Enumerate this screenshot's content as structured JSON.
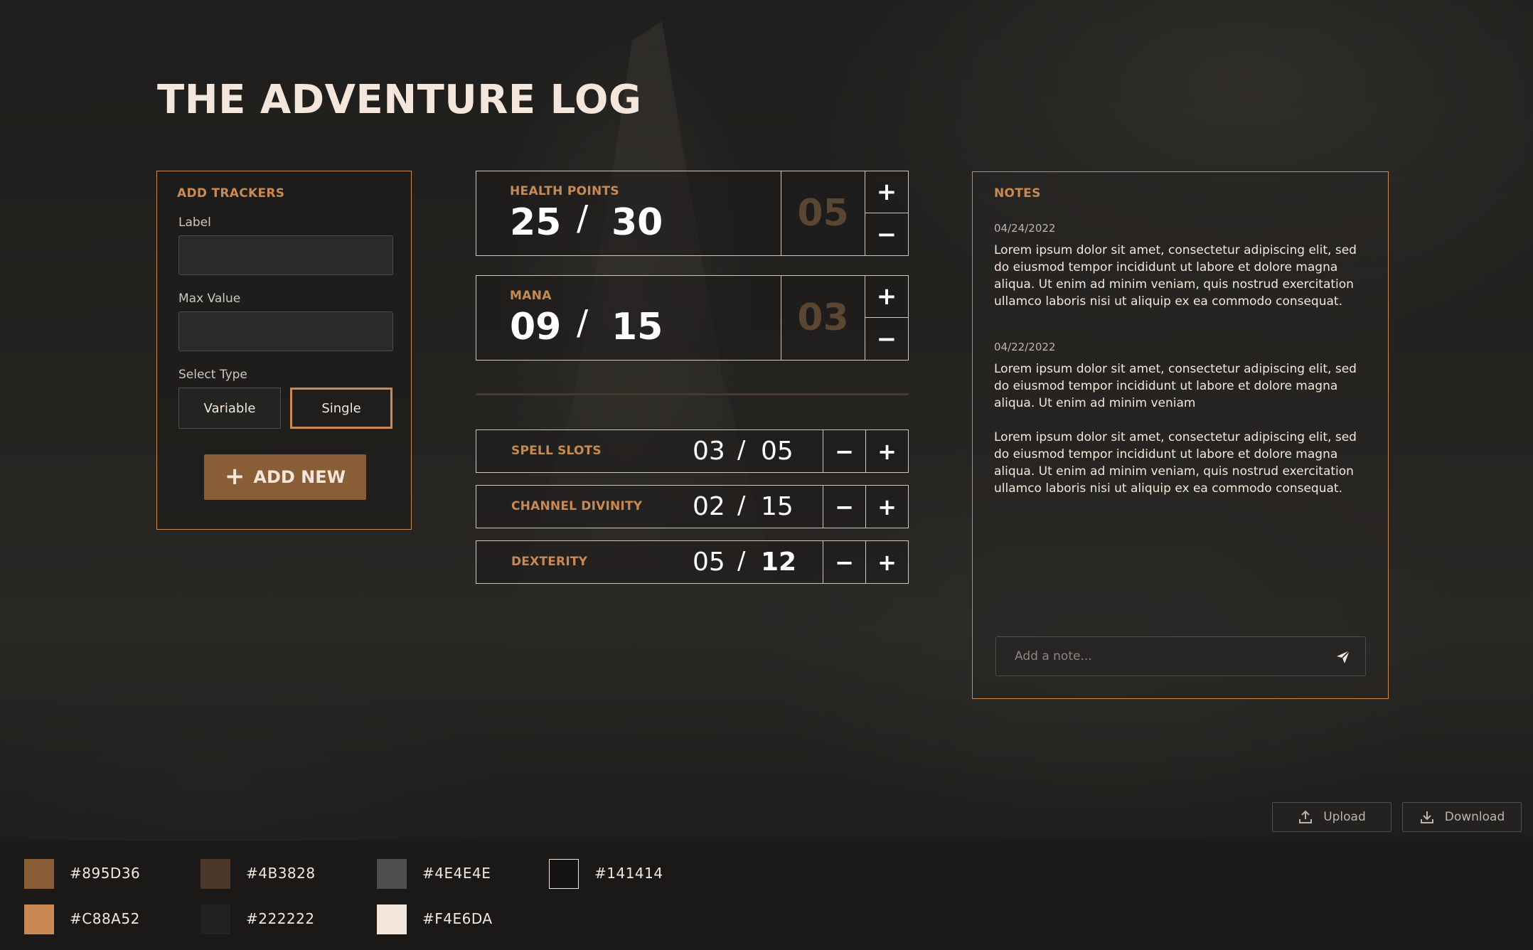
{
  "app": {
    "title": "THE ADVENTURE LOG"
  },
  "add_trackers": {
    "heading": "ADD TRACKERS",
    "label_field": {
      "label": "Label",
      "value": "",
      "placeholder": ""
    },
    "max_field": {
      "label": "Max Value",
      "value": "",
      "placeholder": ""
    },
    "type_label": "Select Type",
    "types": [
      "Variable",
      "Single"
    ],
    "selected_type": "Single",
    "add_button": "ADD NEW",
    "add_icon": "+"
  },
  "big_trackers": [
    {
      "label": "HEALTH POINTS",
      "current": "25",
      "max": "30",
      "delta": "05"
    },
    {
      "label": "MANA",
      "current": "09",
      "max": "15",
      "delta": "03"
    }
  ],
  "small_trackers": [
    {
      "label": "SPELL SLOTS",
      "current": "03",
      "max": "05"
    },
    {
      "label": "CHANNEL DIVINITY",
      "current": "02",
      "max": "15"
    },
    {
      "label": "DEXTERITY",
      "current": "05",
      "max": "12"
    }
  ],
  "symbols": {
    "slash": "/",
    "plus": "+",
    "minus": "−"
  },
  "notes": {
    "heading": "NOTES",
    "entries": [
      {
        "date": "04/24/2022",
        "paragraphs": [
          "Lorem ipsum dolor sit amet, consectetur adipiscing elit, sed do eiusmod tempor incididunt ut labore et dolore magna aliqua. Ut enim ad minim veniam, quis nostrud exercitation ullamco laboris nisi ut aliquip ex ea commodo consequat."
        ]
      },
      {
        "date": "04/22/2022",
        "paragraphs": [
          "Lorem ipsum dolor sit amet, consectetur adipiscing elit, sed do eiusmod tempor incididunt ut labore et dolore magna aliqua. Ut enim ad minim veniam",
          "Lorem ipsum dolor sit amet, consectetur adipiscing elit, sed do eiusmod tempor incididunt ut labore et dolore magna aliqua. Ut enim ad minim veniam, quis nostrud exercitation ullamco laboris nisi ut aliquip ex ea commodo consequat."
        ]
      }
    ],
    "input_placeholder": "Add a note...",
    "send_icon": "send-icon"
  },
  "file_actions": {
    "upload": "Upload",
    "download": "Download",
    "upload_icon": "upload-icon",
    "download_icon": "download-icon"
  },
  "palette": {
    "colors": [
      {
        "hex": "#895D36",
        "label": "#895D36"
      },
      {
        "hex": "#4B3828",
        "label": "#4B3828"
      },
      {
        "hex": "#4E4E4E",
        "label": "#4E4E4E"
      },
      {
        "hex": "#141414",
        "label": "#141414"
      },
      {
        "hex": "#C88A52",
        "label": "#C88A52"
      },
      {
        "hex": "#222222",
        "label": "#222222"
      },
      {
        "hex": "#F4E6DA",
        "label": "#F4E6DA"
      }
    ]
  }
}
